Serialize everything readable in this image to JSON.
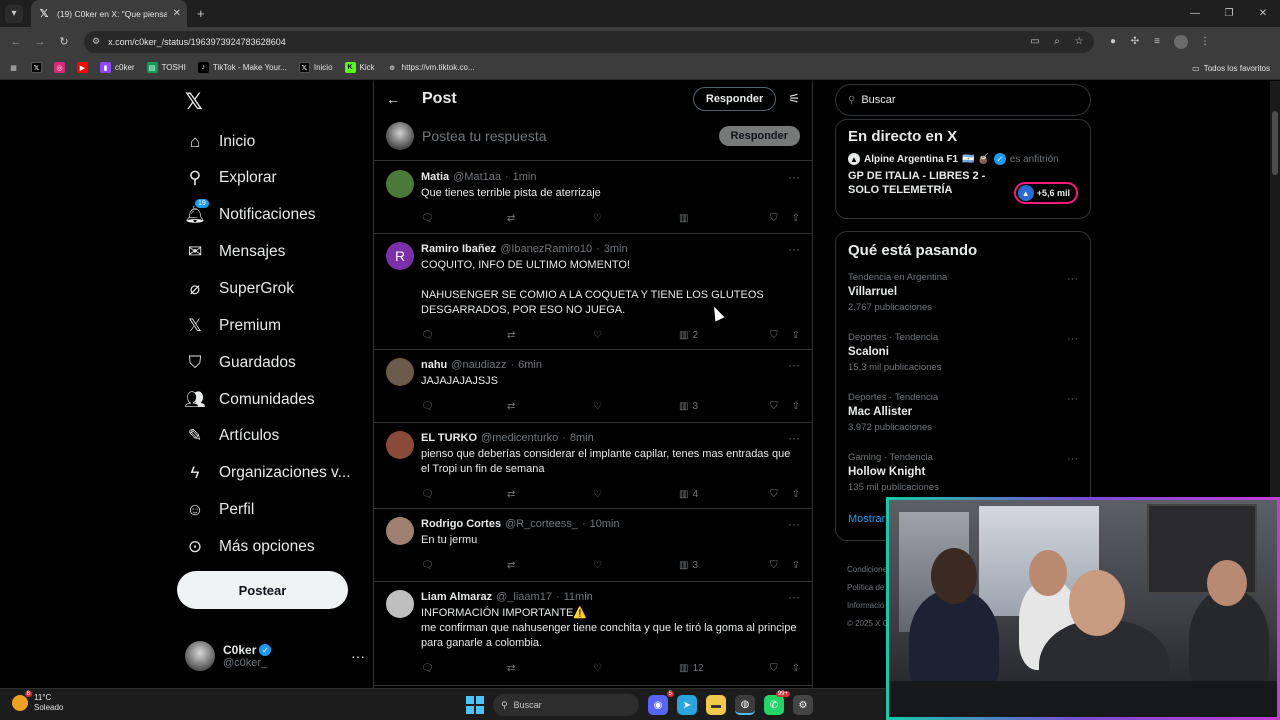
{
  "browser": {
    "tab_title": "(19) C0ker en X: \"Que piensan?\"",
    "url": "x.com/c0ker_/status/1963973924783628604",
    "bookmarks": [
      {
        "label": "",
        "icon": "x-icon",
        "color": "#000000"
      },
      {
        "label": "",
        "icon": "instagram-icon",
        "color": "#d62976"
      },
      {
        "label": "",
        "icon": "youtube-icon",
        "color": "#ff0000"
      },
      {
        "label": "c0ker",
        "icon": "twitch-icon",
        "color": "#9146ff"
      },
      {
        "label": "TOSHI",
        "icon": "sheets-icon",
        "color": "#0f9d58"
      },
      {
        "label": "TikTok - Make Your...",
        "icon": "tiktok-icon",
        "color": "#000000"
      },
      {
        "label": "Inicio",
        "icon": "x-icon",
        "color": "#000000"
      },
      {
        "label": "Kick",
        "icon": "kick-icon",
        "color": "#53fc18"
      },
      {
        "label": "https://vm.tiktok.co...",
        "icon": "globe-icon",
        "color": "#5f6368"
      }
    ],
    "favorites_label": "Todos los favoritos"
  },
  "nav": {
    "items": [
      {
        "label": "Inicio",
        "icon": "home-icon"
      },
      {
        "label": "Explorar",
        "icon": "search-icon"
      },
      {
        "label": "Notificaciones",
        "icon": "bell-icon",
        "badge": "19"
      },
      {
        "label": "Mensajes",
        "icon": "mail-icon"
      },
      {
        "label": "SuperGrok",
        "icon": "grok-icon"
      },
      {
        "label": "Premium",
        "icon": "x-icon"
      },
      {
        "label": "Guardados",
        "icon": "bookmark-icon"
      },
      {
        "label": "Comunidades",
        "icon": "people-icon"
      },
      {
        "label": "Artículos",
        "icon": "article-icon"
      },
      {
        "label": "Organizaciones v...",
        "icon": "lightning-icon"
      },
      {
        "label": "Perfil",
        "icon": "person-icon"
      },
      {
        "label": "Más opciones",
        "icon": "more-circle-icon"
      }
    ],
    "post_label": "Postear",
    "profile": {
      "name": "C0ker",
      "handle": "@c0ker_"
    }
  },
  "center": {
    "title": "Post",
    "reply_button": "Responder",
    "compose_placeholder": "Postea tu respuesta",
    "compose_button": "Responder",
    "tweets": [
      {
        "name": "Matia",
        "handle": "@Mat1aa",
        "time": "1min",
        "text": "Que tienes terrible pista de aterrizaje",
        "views": "",
        "avatar_color": "#4a7a3a"
      },
      {
        "name": "Ramiro Ibañez",
        "handle": "@IbanezRamiro10",
        "time": "3min",
        "text": "COQUITO, INFO DE ULTIMO MOMENTO!\n\nNAHUSENGER SE COMIO A LA COQUETA Y TIENE LOS GLUTEOS DESGARRADOS, POR ESO NO JUEGA.",
        "views": "2",
        "avatar_color": "#7b2fa8",
        "avatar_letter": "R"
      },
      {
        "name": "nahu",
        "handle": "@naudiazz",
        "time": "6min",
        "text": "JAJAJAJAJSJS",
        "views": "3",
        "avatar_color": "#6a5a4a"
      },
      {
        "name": "EL TURKO",
        "handle": "@medicenturko",
        "time": "8min",
        "text": "pienso que deberías considerar el implante capilar, tenes mas entradas que el Tropi un fin de semana",
        "views": "4",
        "avatar_color": "#8a4a3a"
      },
      {
        "name": "Rodrigo Cortes",
        "handle": "@R_corteess_",
        "time": "10min",
        "text": "En tu jermu",
        "views": "3",
        "avatar_color": "#a08070"
      },
      {
        "name": "Liam Almaraz",
        "handle": "@_liaam17",
        "time": "11min",
        "text": "INFORMACIÓN IMPORTANTE⚠️\nme confirman que nahusenger tiene conchita y que le tiró la goma al principe para ganarle a colombia.",
        "views": "12",
        "avatar_color": "#bfbfbf"
      }
    ]
  },
  "right": {
    "search_placeholder": "Buscar",
    "live": {
      "title": "En directo en X",
      "host": "Alpine Argentina F1",
      "host_flags": "🇦🇷 🧉",
      "host_role": "es anfitrión",
      "event": "GP DE ITALIA - LIBRES 2 - SOLO TELEMETRÍA",
      "listeners": "+5,6 mil"
    },
    "trends_title": "Qué está pasando",
    "trends": [
      {
        "context": "Tendencia en Argentina",
        "name": "Villarruel",
        "count": "2.767 publicaciones"
      },
      {
        "context": "Deportes · Tendencia",
        "name": "Scaloni",
        "count": "15,3 mil publicaciones"
      },
      {
        "context": "Deportes · Tendencia",
        "name": "Mac Allister",
        "count": "3.972 publicaciones"
      },
      {
        "context": "Gaming · Tendencia",
        "name": "Hollow Knight",
        "count": "135 mil publicaciones"
      }
    ],
    "show_more": "Mostrar",
    "footer": [
      "Condicione",
      "Política de",
      "Informació",
      "© 2025 X C"
    ]
  },
  "taskbar": {
    "temperature": "11°C",
    "weather": "Soleado",
    "weather_badge": "8",
    "search_placeholder": "Buscar",
    "discord_badge": "5",
    "whatsapp_badge": "99+"
  }
}
